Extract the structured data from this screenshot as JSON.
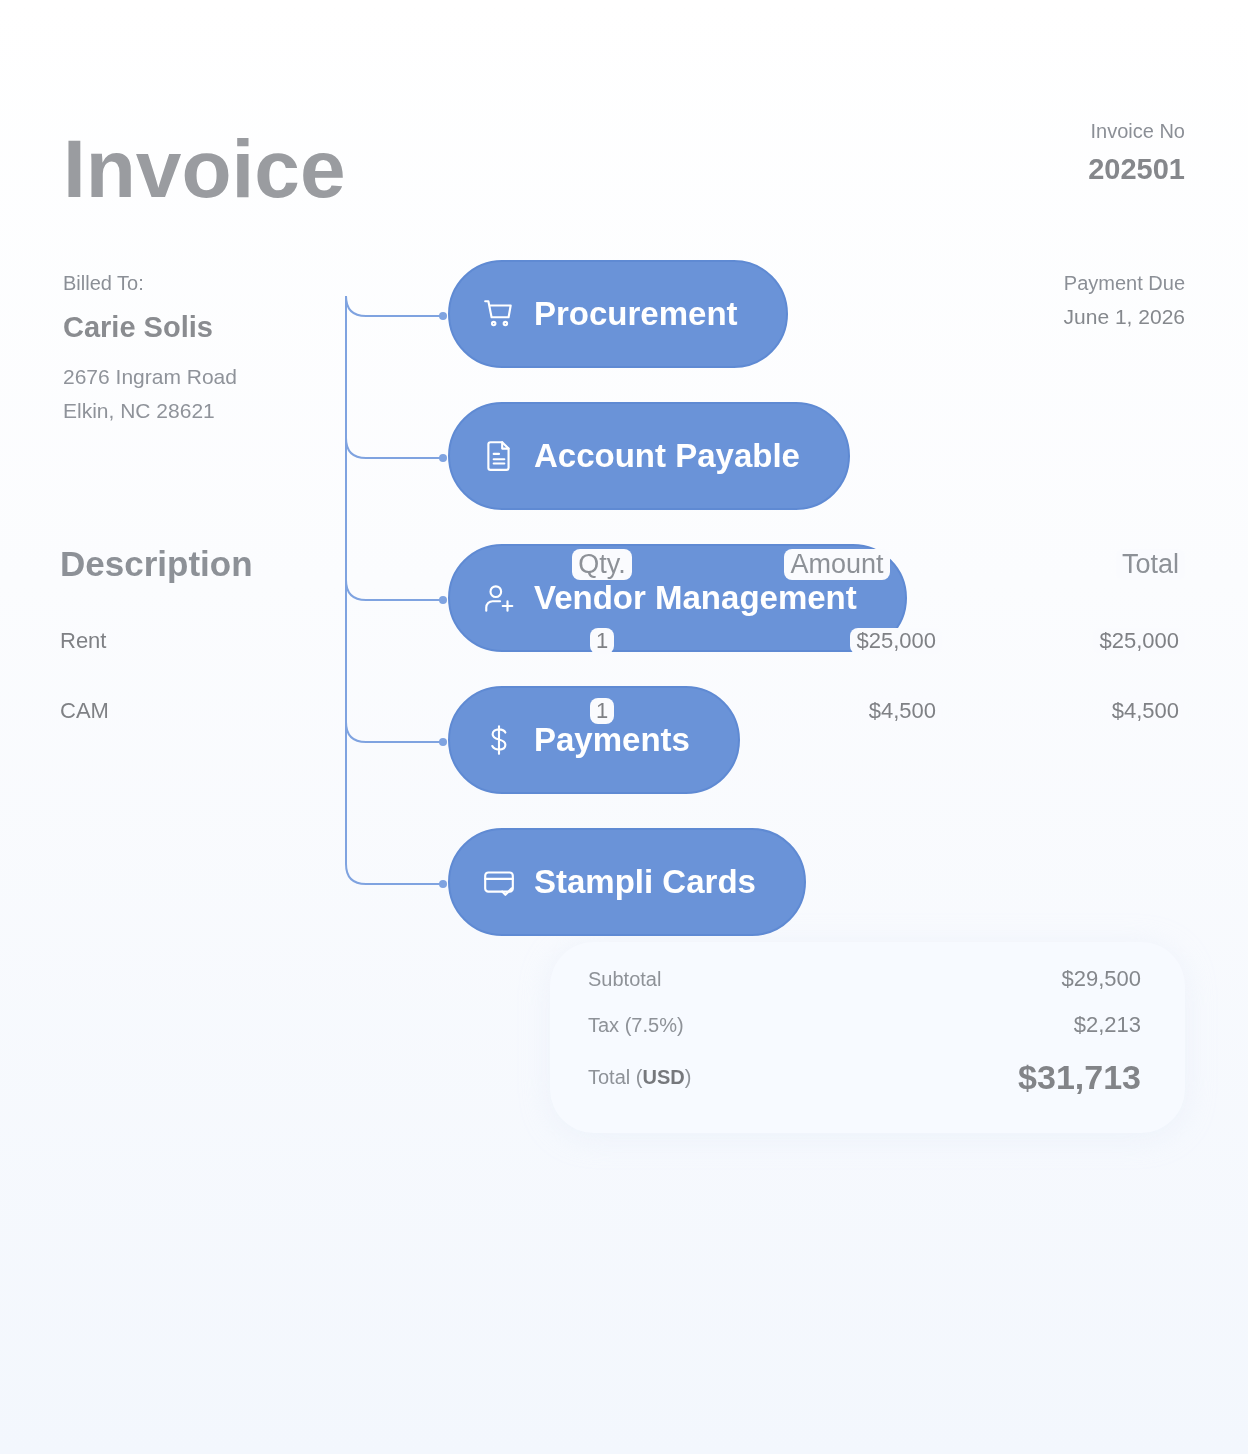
{
  "invoice": {
    "title": "Invoice",
    "number_label": "Invoice No",
    "number": "202501",
    "billed_to": {
      "label": "Billed To:",
      "name": "Carie Solis",
      "address": [
        "2676 Ingram Road",
        "Elkin, NC 28621"
      ]
    },
    "payment_due": {
      "label": "Payment Due",
      "date": "June 1, 2026"
    }
  },
  "table": {
    "columns": [
      "Description",
      "Qty.",
      "Amount",
      "Total"
    ],
    "rows": [
      {
        "description": "Rent",
        "qty": "1",
        "amount": "$25,000",
        "total": "$25,000"
      },
      {
        "description": "CAM",
        "qty": "1",
        "amount": "$4,500",
        "total": "$4,500"
      }
    ]
  },
  "summary": [
    {
      "label": "Subtotal",
      "value": "$29,500",
      "kind": "line"
    },
    {
      "label": "Tax (7.5%)",
      "value": "$2,213",
      "kind": "line"
    },
    {
      "label": "Total (**USD**)",
      "value": "$31,713",
      "kind": "grand"
    }
  ],
  "workflow": [
    {
      "label": "Procurement"
    },
    {
      "label": "Account Payable"
    },
    {
      "label": "Vendor Management"
    },
    {
      "label": "Payments"
    },
    {
      "label": "Stampli Cards"
    }
  ]
}
